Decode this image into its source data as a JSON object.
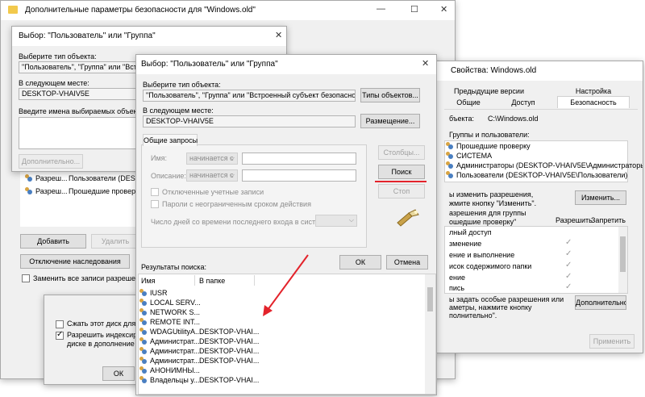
{
  "props_window": {
    "title": "Дополнительные параметры безопасности  для \"Windows.old\"",
    "add_label": "Добавить",
    "remove_label": "Удалить",
    "disable_inheritance_label": "Отключение наследования",
    "replace_all_label": "Заменить все записи разрешения",
    "rows": [
      {
        "type": "Разреш...",
        "principal": "Пользователи (DESKTOP-"
      },
      {
        "type": "Разреш...",
        "principal": "Прошедшие проверк"
      }
    ]
  },
  "folder_window": {
    "title": "Свойства: Windows.old",
    "tabs_top": [
      "Предыдущие версии",
      "Настройка"
    ],
    "tabs_bottom": [
      "Общие",
      "Доступ",
      "Безопасность"
    ],
    "object_name_label": "бъекта:",
    "object_name_value": "C:\\Windows.old",
    "groups_label": "Группы и пользователи:",
    "groups": [
      "Прошедшие проверку",
      "СИСТЕМА",
      "Администраторы (DESKTOP-VHAIV5E\\Администраторы)",
      "Пользователи (DESKTOP-VHAIV5E\\Пользователи)"
    ],
    "change_hint": "ы изменить разрешения,\nжмите кнопку \"Изменить\".",
    "change_label": "Изменить...",
    "perm_for_label": "азрешения для группы\nошедшие проверку\"",
    "allow_label": "Разрешить",
    "deny_label": "Запретить",
    "perms": [
      "лный доступ",
      "зменение",
      "ение и выполнение",
      "исок содержимого папки",
      "ение",
      "пись"
    ],
    "special_hint": "ы задать особые разрешения или\nаметры, нажмите кнопку\nполнительно\".",
    "advanced_label": "Дополнительно",
    "apply_label": "Применить"
  },
  "general_window": {
    "compress_label": "Сжать этот диск для эк",
    "index_label": "Разрешить индексирова\nдиске в дополнение к",
    "ok_label": "ОК"
  },
  "back_dialog": {
    "title": "Выбор: \"Пользователь\" или \"Группа\"",
    "object_type_label": "Выберите тип объекта:",
    "object_type_value": "\"Пользователь\", \"Группа\" или \"Встроен",
    "location_label": "В следующем месте:",
    "location_value": "DESKTOP-VHAIV5E",
    "names_label": "Введите имена выбираемых объектов",
    "advanced_label": "Дополнительно..."
  },
  "front_dialog": {
    "title": "Выбор: \"Пользователь\" или \"Группа\"",
    "object_type_label": "Выберите тип объекта:",
    "object_type_value": "\"Пользователь\", \"Группа\" или \"Встроенный субъект безопасности\"",
    "object_types_button": "Типы объектов...",
    "location_label": "В следующем месте:",
    "location_value": "DESKTOP-VHAIV5E",
    "location_button": "Размещение...",
    "common_queries_tab": "Общие запросы",
    "name_label": "Имя:",
    "name_mode": "начинается с",
    "description_label": "Описание:",
    "description_mode": "начинается с",
    "disabled_accounts_label": "Отключенные учетные записи",
    "nonexpiring_label": "Пароли с неограниченным сроком действия",
    "days_label": "Число дней со времени последнего входа в систему:",
    "columns_button": "Столбцы...",
    "search_button": "Поиск",
    "stop_button": "Стоп",
    "ok_button": "ОК",
    "cancel_button": "Отмена",
    "results_label": "Результаты поиска:",
    "col_name": "Имя",
    "col_folder": "В папке",
    "results": [
      {
        "name": "IUSR",
        "folder": ""
      },
      {
        "name": "LOCAL SERV...",
        "folder": ""
      },
      {
        "name": "NETWORK S...",
        "folder": ""
      },
      {
        "name": "REMOTE INT...",
        "folder": ""
      },
      {
        "name": "WDAGUtilityA...",
        "folder": "DESKTOP-VHAI..."
      },
      {
        "name": "Администрат...",
        "folder": "DESKTOP-VHAI..."
      },
      {
        "name": "Администрат...",
        "folder": "DESKTOP-VHAI..."
      },
      {
        "name": "Администрат...",
        "folder": "DESKTOP-VHAI..."
      },
      {
        "name": "АНОНИМНЫ...",
        "folder": ""
      },
      {
        "name": "Владельцы у...",
        "folder": "DESKTOP-VHAI..."
      }
    ]
  },
  "annotations": {
    "accent_color": "#e3232b"
  }
}
